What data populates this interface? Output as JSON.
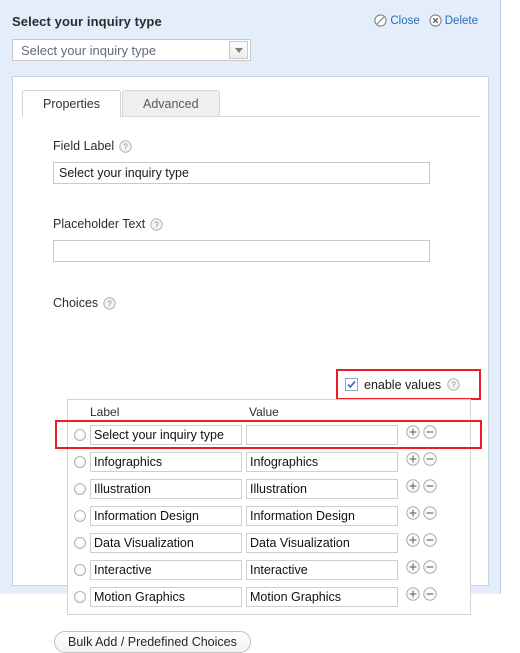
{
  "header": {
    "field_title": "Select your inquiry type",
    "close_label": "Close",
    "delete_label": "Delete"
  },
  "preview": {
    "select_value": "Select your inquiry type"
  },
  "tabs": [
    {
      "label": "Properties",
      "active": true
    },
    {
      "label": "Advanced",
      "active": false
    }
  ],
  "field_label": {
    "label": "Field Label",
    "value": "Select your inquiry type",
    "placeholder": ""
  },
  "placeholder_text": {
    "label": "Placeholder Text",
    "value": "",
    "placeholder": ""
  },
  "choices": {
    "label": "Choices",
    "enable_values_label": "enable values",
    "enable_values_checked": true,
    "columns": {
      "label": "Label",
      "value": "Value"
    },
    "rows": [
      {
        "label": "Select your inquiry type",
        "value": ""
      },
      {
        "label": "Infographics",
        "value": "Infographics"
      },
      {
        "label": "Illustration",
        "value": "Illustration"
      },
      {
        "label": "Information Design",
        "value": "Information Design"
      },
      {
        "label": "Data Visualization",
        "value": "Data Visualization"
      },
      {
        "label": "Interactive",
        "value": "Interactive"
      },
      {
        "label": "Motion Graphics",
        "value": "Motion Graphics"
      }
    ],
    "add_row_icon": "plus-circle-icon",
    "remove_row_icon": "minus-circle-icon"
  },
  "bulk_add": {
    "label": "Bulk Add / Predefined Choices"
  },
  "colors": {
    "panel_blue": "#e4eefb",
    "highlight_red": "#ee1c25",
    "link_blue": "#2a6cb5"
  }
}
